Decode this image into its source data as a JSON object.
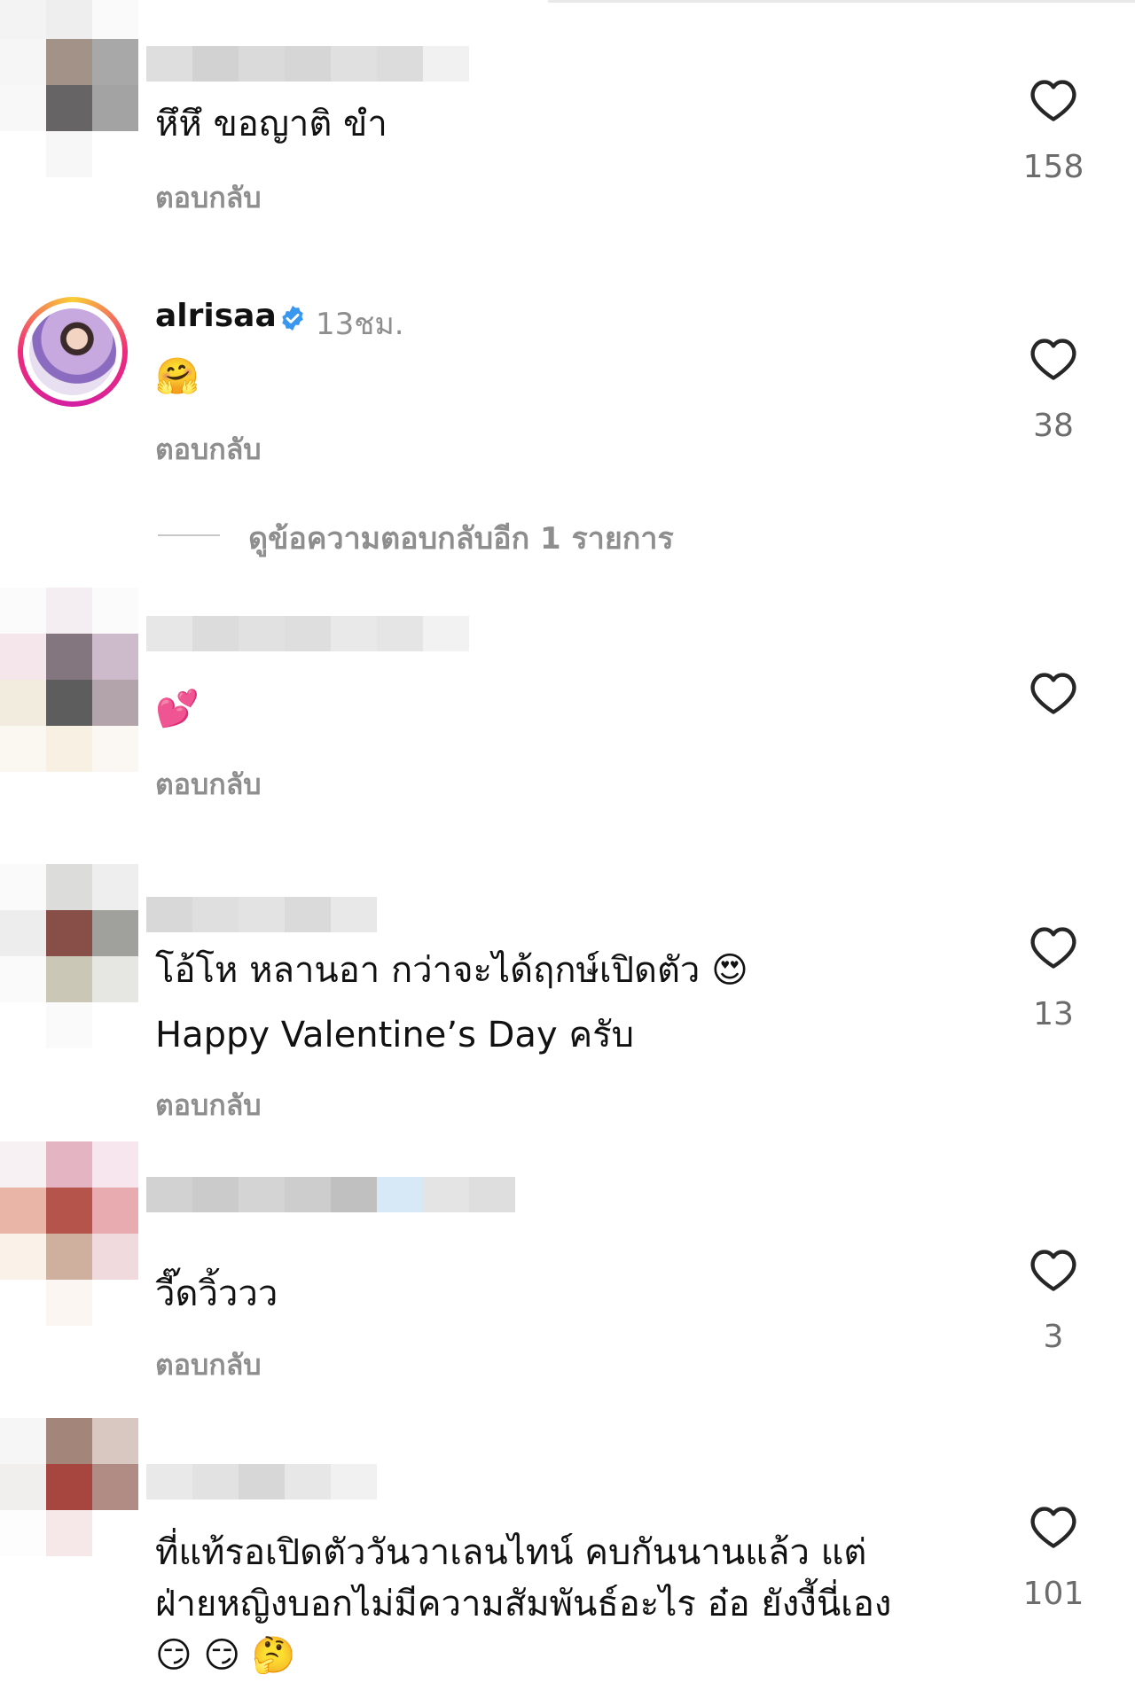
{
  "comments": [
    {
      "text": "หึหึ ขอญาติ ขำ",
      "reply": "ตอบกลับ",
      "likes": "158"
    },
    {
      "username": "alrisaa",
      "time": "13ชม.",
      "text": "🤗",
      "reply": "ตอบกลับ",
      "likes": "38",
      "view_replies": "ดูข้อความตอบกลับอีก 1 รายการ"
    },
    {
      "text": "💕",
      "reply": "ตอบกลับ"
    },
    {
      "text_line1": "โอ้โห หลานอา กว่าจะได้ฤกษ์เปิดตัว 😍",
      "text_line2": "Happy Valentine’s Day ครับ",
      "reply": "ตอบกลับ",
      "likes": "13"
    },
    {
      "text": "วี๊ดวิ้ววว",
      "reply": "ตอบกลับ",
      "likes": "3"
    },
    {
      "text_line1": "ที่แท้รอเปิดตัววันวาเลนไทน์ คบกันนานแล้ว แต่",
      "text_line2": "ฝ่ายหญิงบอกไม่มีความสัมพันธ์อะไร อ๋อ ยังงี้นี่เอง",
      "text_line3": "😏 😏 🤔",
      "likes": "101"
    }
  ],
  "icons": {
    "like": "heart-outline-icon",
    "verified": "verified-badge-icon"
  },
  "colors": {
    "text": "#111111",
    "secondary": "#8e8e8e",
    "verified": "#3897f0"
  }
}
